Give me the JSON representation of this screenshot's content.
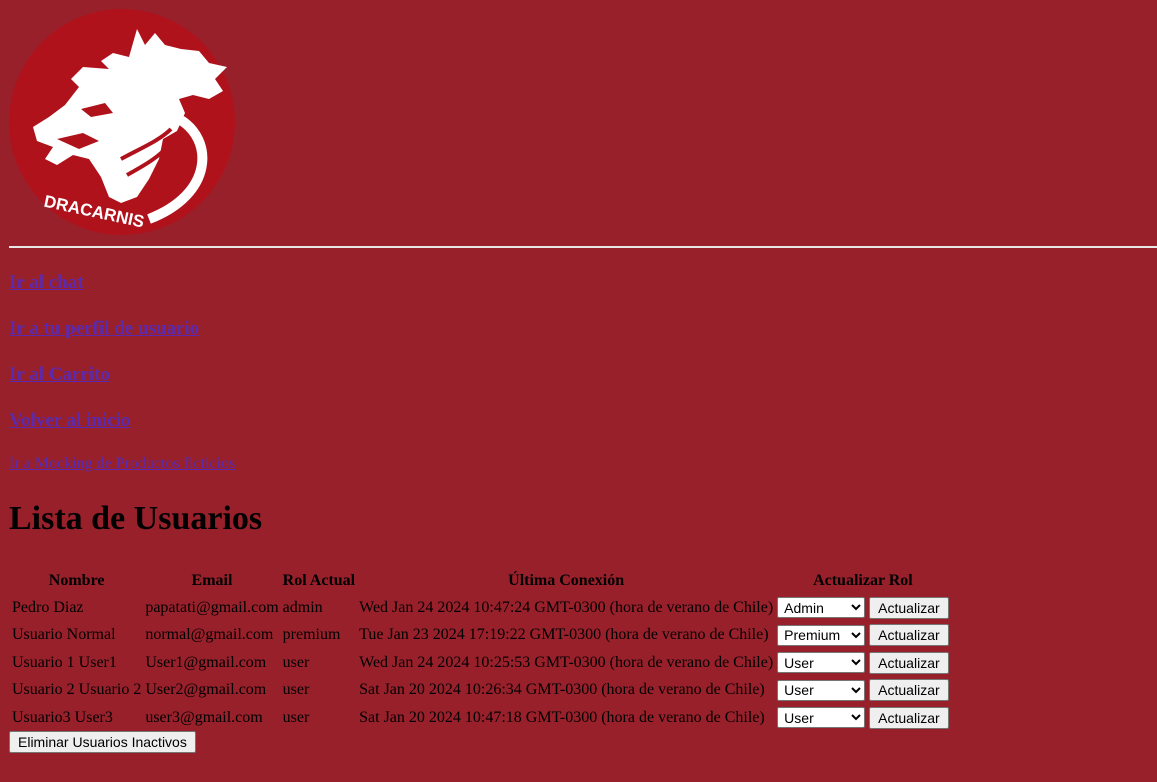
{
  "logo": {
    "text": "DRACARNIS",
    "colors": {
      "circle": "#b0121c",
      "dragon": "#ffffff"
    }
  },
  "nav": {
    "chat": "Ir al chat",
    "profile": "Ir a tu perfil de usuario",
    "cart": "Ir al Carrito",
    "home": "Volver al inicio",
    "mocking": "Ir a Mocking de Productos ficticios"
  },
  "page_title": "Lista de Usuarios",
  "table": {
    "headers": {
      "name": "Nombre",
      "email": "Email",
      "role": "Rol Actual",
      "last": "Última Conexión",
      "update": "Actualizar Rol"
    },
    "rows": [
      {
        "name": "Pedro Diaz",
        "email": "papatati@gmail.com",
        "role": "admin",
        "last": "Wed Jan 24 2024 10:47:24 GMT-0300 (hora de verano de Chile)",
        "selected": "Admin",
        "button": "Actualizar"
      },
      {
        "name": "Usuario Normal",
        "email": "normal@gmail.com",
        "role": "premium",
        "last": "Tue Jan 23 2024 17:19:22 GMT-0300 (hora de verano de Chile)",
        "selected": "Premium",
        "button": "Actualizar"
      },
      {
        "name": "Usuario 1 User1",
        "email": "User1@gmail.com",
        "role": "user",
        "last": "Wed Jan 24 2024 10:25:53 GMT-0300 (hora de verano de Chile)",
        "selected": "User",
        "button": "Actualizar"
      },
      {
        "name": "Usuario 2 Usuario 2",
        "email": "User2@gmail.com",
        "role": "user",
        "last": "Sat Jan 20 2024 10:26:34 GMT-0300 (hora de verano de Chile)",
        "selected": "User",
        "button": "Actualizar"
      },
      {
        "name": "Usuario3 User3",
        "email": "user3@gmail.com",
        "role": "user",
        "last": "Sat Jan 20 2024 10:47:18 GMT-0300 (hora de verano de Chile)",
        "selected": "User",
        "button": "Actualizar"
      }
    ]
  },
  "delete_button": "Eliminar Usuarios Inactivos",
  "colors": {
    "background": "#98202b",
    "link": "#5a2bb0"
  }
}
